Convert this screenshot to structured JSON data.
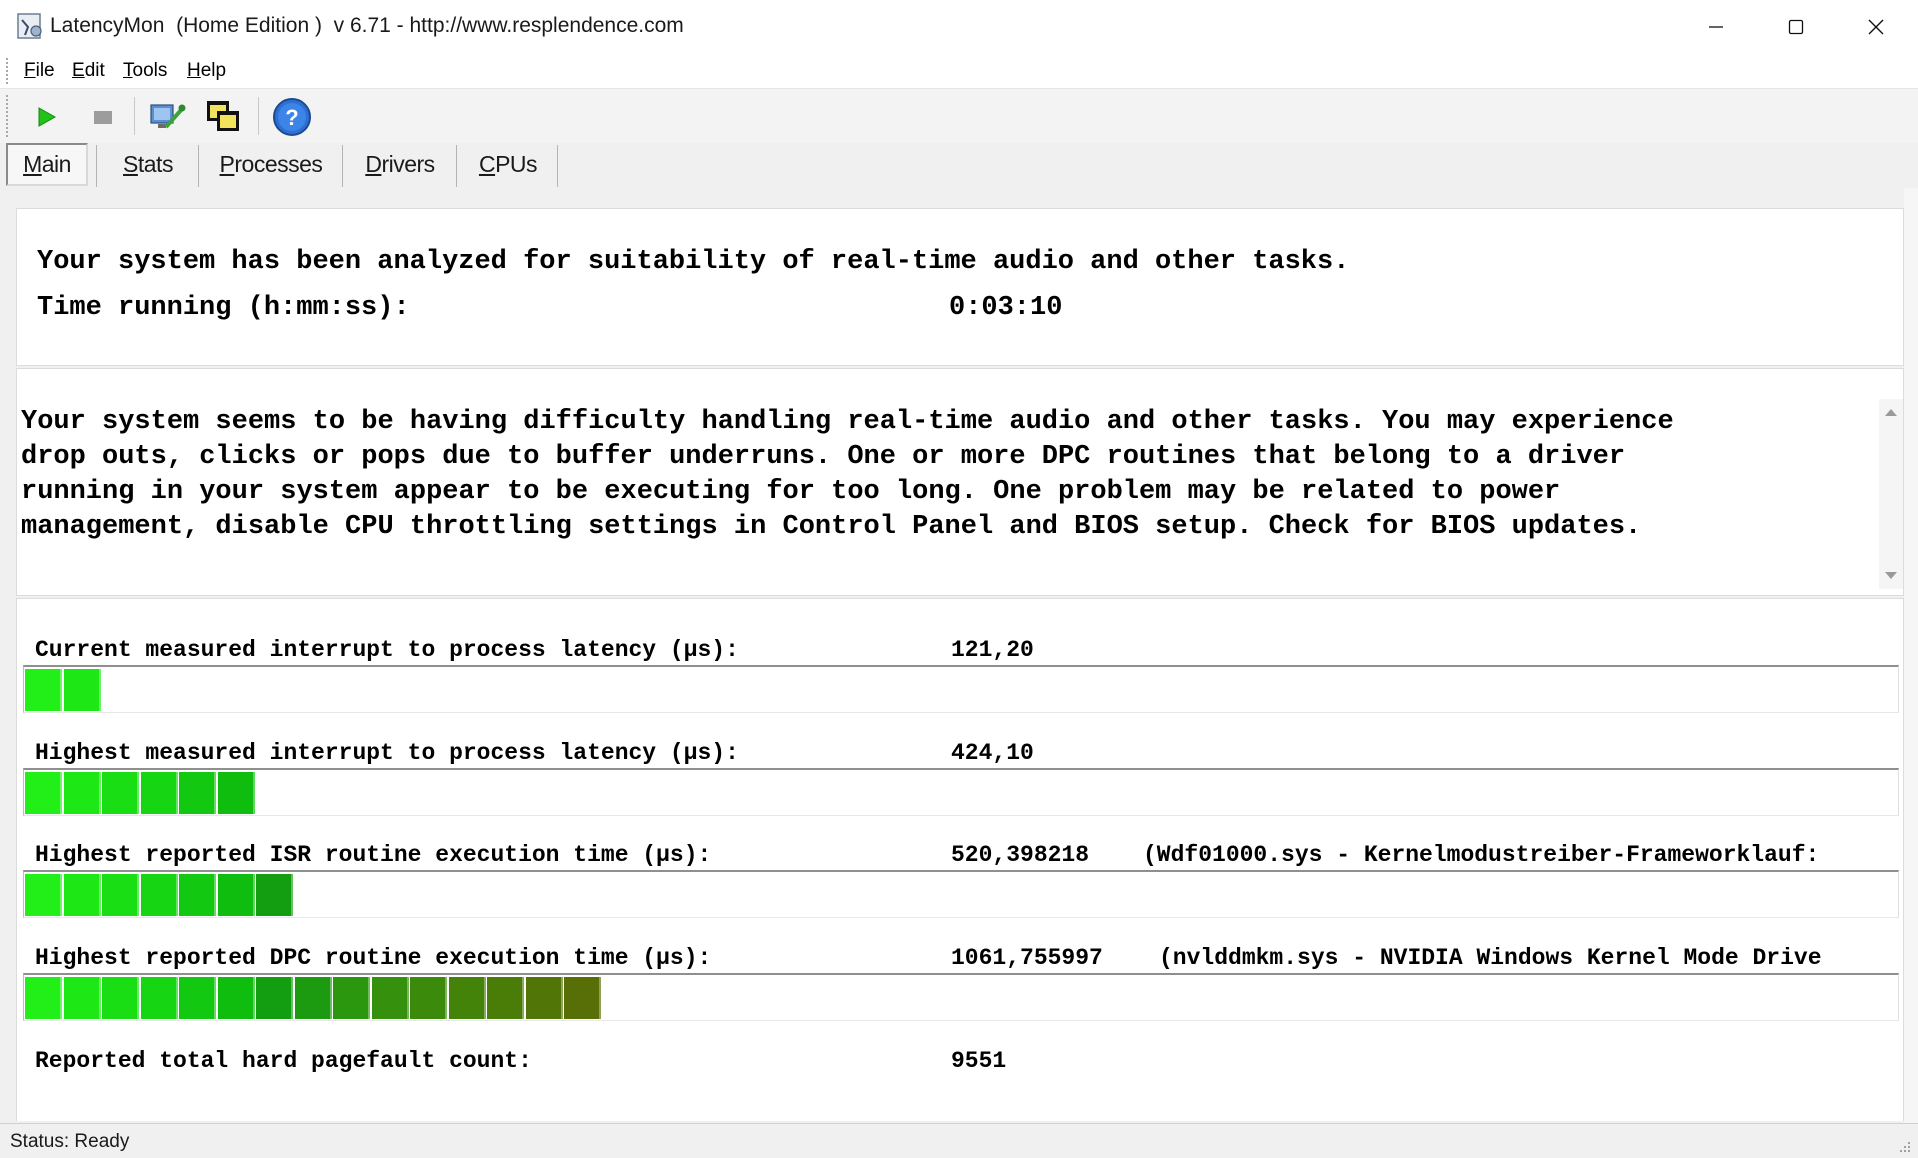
{
  "window": {
    "title": "LatencyMon  (Home Edition )  v 6.71 - http://www.resplendence.com",
    "minimize_icon": "minimize-icon",
    "maximize_icon": "maximize-icon",
    "close_icon": "close-icon"
  },
  "menu": [
    {
      "key": "F",
      "rest": "ile"
    },
    {
      "key": "E",
      "rest": "dit"
    },
    {
      "key": "T",
      "rest": "ools"
    },
    {
      "key": "H",
      "rest": "elp"
    }
  ],
  "toolbar": {
    "icons": [
      "play-icon",
      "stop-icon",
      "monitor-wrench-icon",
      "window-stack-icon",
      "help-icon"
    ]
  },
  "tabs": [
    {
      "key": "M",
      "rest": "ain",
      "active": true
    },
    {
      "key": "S",
      "rest": "tats",
      "active": false
    },
    {
      "key": "P",
      "rest": "rocesses",
      "active": false
    },
    {
      "key": "D",
      "rest": "rivers",
      "active": false
    },
    {
      "key": "C",
      "rest": "PUs",
      "active": false
    }
  ],
  "summary": {
    "headline": "Your system has been analyzed for suitability of real-time audio and other tasks.",
    "time_label": "Time running (h:mm:ss):",
    "time_value": "0:03:10"
  },
  "verdict": {
    "lines": [
      "Your system seems to be having difficulty handling real-time audio and other tasks. You may experience",
      "drop outs, clicks or pops due to buffer underruns. One or more DPC routines that belong to a driver",
      "running in your system appear to be executing for too long. One problem may be related to power",
      "management, disable CPU throttling settings in Control Panel and BIOS setup. Check for BIOS updates."
    ]
  },
  "metrics": [
    {
      "label": "Current measured interrupt to process latency (µs):",
      "value": "121,20",
      "detail": "",
      "fill_segments": 2
    },
    {
      "label": "Highest measured interrupt to process latency (µs):",
      "value": "424,10",
      "detail": "",
      "fill_segments": 6
    },
    {
      "label": "Highest reported ISR routine execution time (µs):",
      "value": "520,398218",
      "detail": "(Wdf01000.sys - Kernelmodustreiber-Frameworklauf:",
      "fill_segments": 7
    },
    {
      "label": "Highest reported DPC routine execution time (µs):",
      "value": "1061,755997",
      "detail": "(nvlddmkm.sys - NVIDIA Windows Kernel Mode Drive",
      "fill_segments": 15
    },
    {
      "label": "Reported total hard pagefault count:",
      "value": "9551",
      "detail": "",
      "fill_segments": 0
    }
  ],
  "bar_colors": [
    "#22ee18",
    "#1ee716",
    "#19de14",
    "#16d512",
    "#12c810",
    "#0fbd0e",
    "#139e11",
    "#1c9a10",
    "#2a970e",
    "#34900d",
    "#3c8a0c",
    "#438309",
    "#4a7c08",
    "#517507",
    "#586e06"
  ],
  "status": {
    "text": "Status: Ready"
  }
}
